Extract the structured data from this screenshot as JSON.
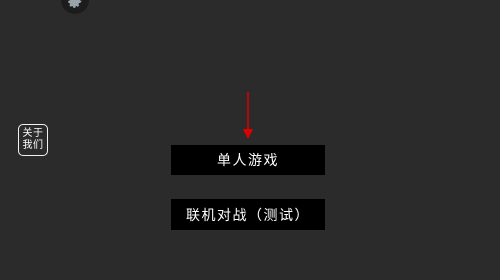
{
  "icons": {
    "settings": "gear-icon",
    "pointer": "arrow-down-icon"
  },
  "colors": {
    "background": "#2b2b2b",
    "button_bg": "#000000",
    "text": "#ffffff",
    "arrow": "#e00000"
  },
  "about": {
    "line1": "关于",
    "line2": "我们"
  },
  "menu": {
    "single_player_label": "单人游戏",
    "online_battle_label": "联机对战（测试）"
  }
}
